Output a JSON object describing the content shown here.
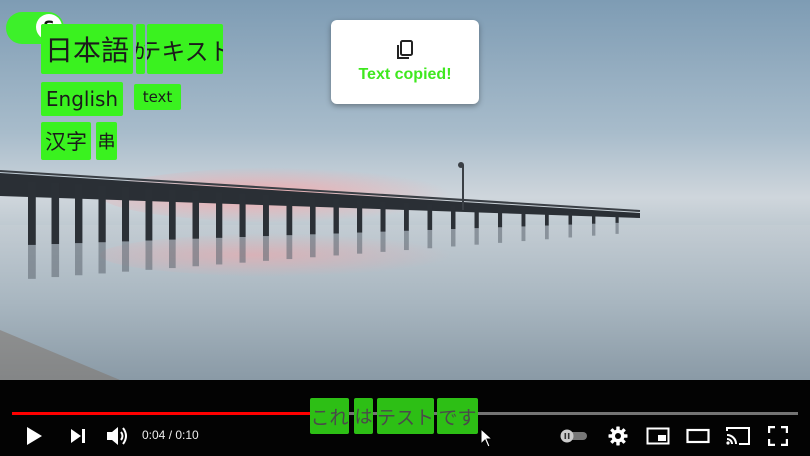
{
  "extension": {
    "toggle_letter": "S"
  },
  "overlay_words": [
    {
      "text": "日本語"
    },
    {
      "text": "が"
    },
    {
      "text": "テキスト"
    },
    {
      "text": "English"
    },
    {
      "text": "text"
    },
    {
      "text": "汉字"
    },
    {
      "text": "串"
    }
  ],
  "toast": {
    "message": "Text copied!",
    "icon": "copy-icon"
  },
  "subtitle_words": [
    {
      "text": "これ"
    },
    {
      "text": "は"
    },
    {
      "text": "テスト"
    },
    {
      "text": "です"
    }
  ],
  "player": {
    "current_time": "0:04",
    "separator": " / ",
    "duration": "0:10",
    "progress_fraction": 0.4,
    "icons": [
      "play-icon",
      "next-icon",
      "volume-icon",
      "autoplay-toggle-icon",
      "settings-gear-icon",
      "miniplayer-icon",
      "theater-mode-icon",
      "cast-icon",
      "fullscreen-icon"
    ]
  },
  "colors": {
    "overlay_green": "#3af21f",
    "toast_text": "#3fe81f",
    "progress": "#ff0000"
  }
}
